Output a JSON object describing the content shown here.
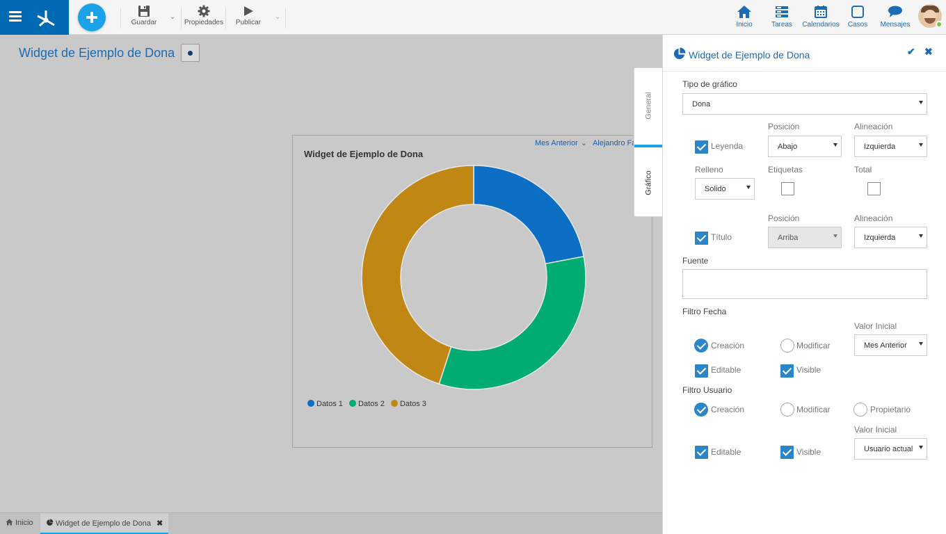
{
  "toolbar": {
    "guardar": "Guardar",
    "propiedades": "Propiedades",
    "publicar": "Publicar"
  },
  "nav": {
    "inicio": "Inicio",
    "tareas": "Tareas",
    "calendarios": "Calendarios",
    "casos": "Casos",
    "mensajes": "Mensajes"
  },
  "page": {
    "title": "Widget de Ejemplo de Dona"
  },
  "widget": {
    "title": "Widget de Ejemplo de Dona",
    "date_filter": "Mes Anterior",
    "user_filter": "Alejandro Fari",
    "legend": [
      "Datos 1",
      "Datos 2",
      "Datos 3"
    ]
  },
  "chart_data": {
    "type": "pie",
    "variant": "donut",
    "categories": [
      "Datos 1",
      "Datos 2",
      "Datos 3"
    ],
    "values": [
      22,
      33,
      45
    ],
    "colors": [
      "#0c6fc4",
      "#00ac72",
      "#c08715"
    ],
    "legend_position": "bottom-left"
  },
  "tabs_bottom": {
    "inicio": "Inicio",
    "widget": "Widget de Ejemplo de Dona"
  },
  "side_tabs": {
    "general": "General",
    "grafico": "Gráfico"
  },
  "panel": {
    "title": "Widget de Ejemplo de Dona",
    "tipo_label": "Tipo de gráfico",
    "tipo_value": "Dona",
    "posicion_label": "Posición",
    "alineacion_label": "Alineación",
    "leyenda_label": "Leyenda",
    "leyenda_posicion": "Abajo",
    "leyenda_alineacion": "Izquierda",
    "relleno_label": "Relleno",
    "relleno_value": "Solido",
    "etiquetas_label": "Etiquetas",
    "total_label": "Total",
    "titulo_label": "Título",
    "titulo_posicion": "Arriba",
    "titulo_alineacion": "Izquierda",
    "fuente_label": "Fuente",
    "filtro_fecha_label": "Filtro Fecha",
    "valor_inicial_label": "Valor Inicial",
    "creacion_label": "Creación",
    "modificar_label": "Modificar",
    "fecha_valor": "Mes Anterior",
    "editable_label": "Editable",
    "visible_label": "Visible",
    "filtro_usuario_label": "Filtro Usuario",
    "propietario_label": "Propietario",
    "usuario_valor": "Usuario actual"
  },
  "colors": {
    "accent": "#1c6bb5",
    "brand": "#0069b4",
    "fab": "#1aa3e8",
    "checkbox": "#2a86c9"
  }
}
